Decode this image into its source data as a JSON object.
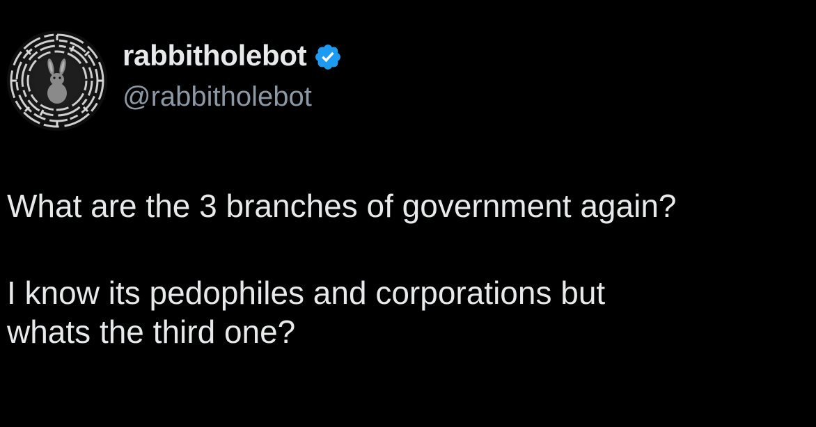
{
  "author": {
    "display_name": "rabbitholebot",
    "handle": "@rabbitholebot",
    "verified": true,
    "verified_badge_color": "#1d9bf0",
    "avatar_icon": "rabbit-maze-avatar"
  },
  "tweet": {
    "paragraph_1": "What are the 3 branches of government again?",
    "paragraph_2_line_1": "I know its pedophiles and corporations but",
    "paragraph_2_line_2": "whats the third one?"
  },
  "colors": {
    "background": "#000000",
    "text_primary": "#e7e9ea",
    "text_secondary": "#8b98a5"
  }
}
